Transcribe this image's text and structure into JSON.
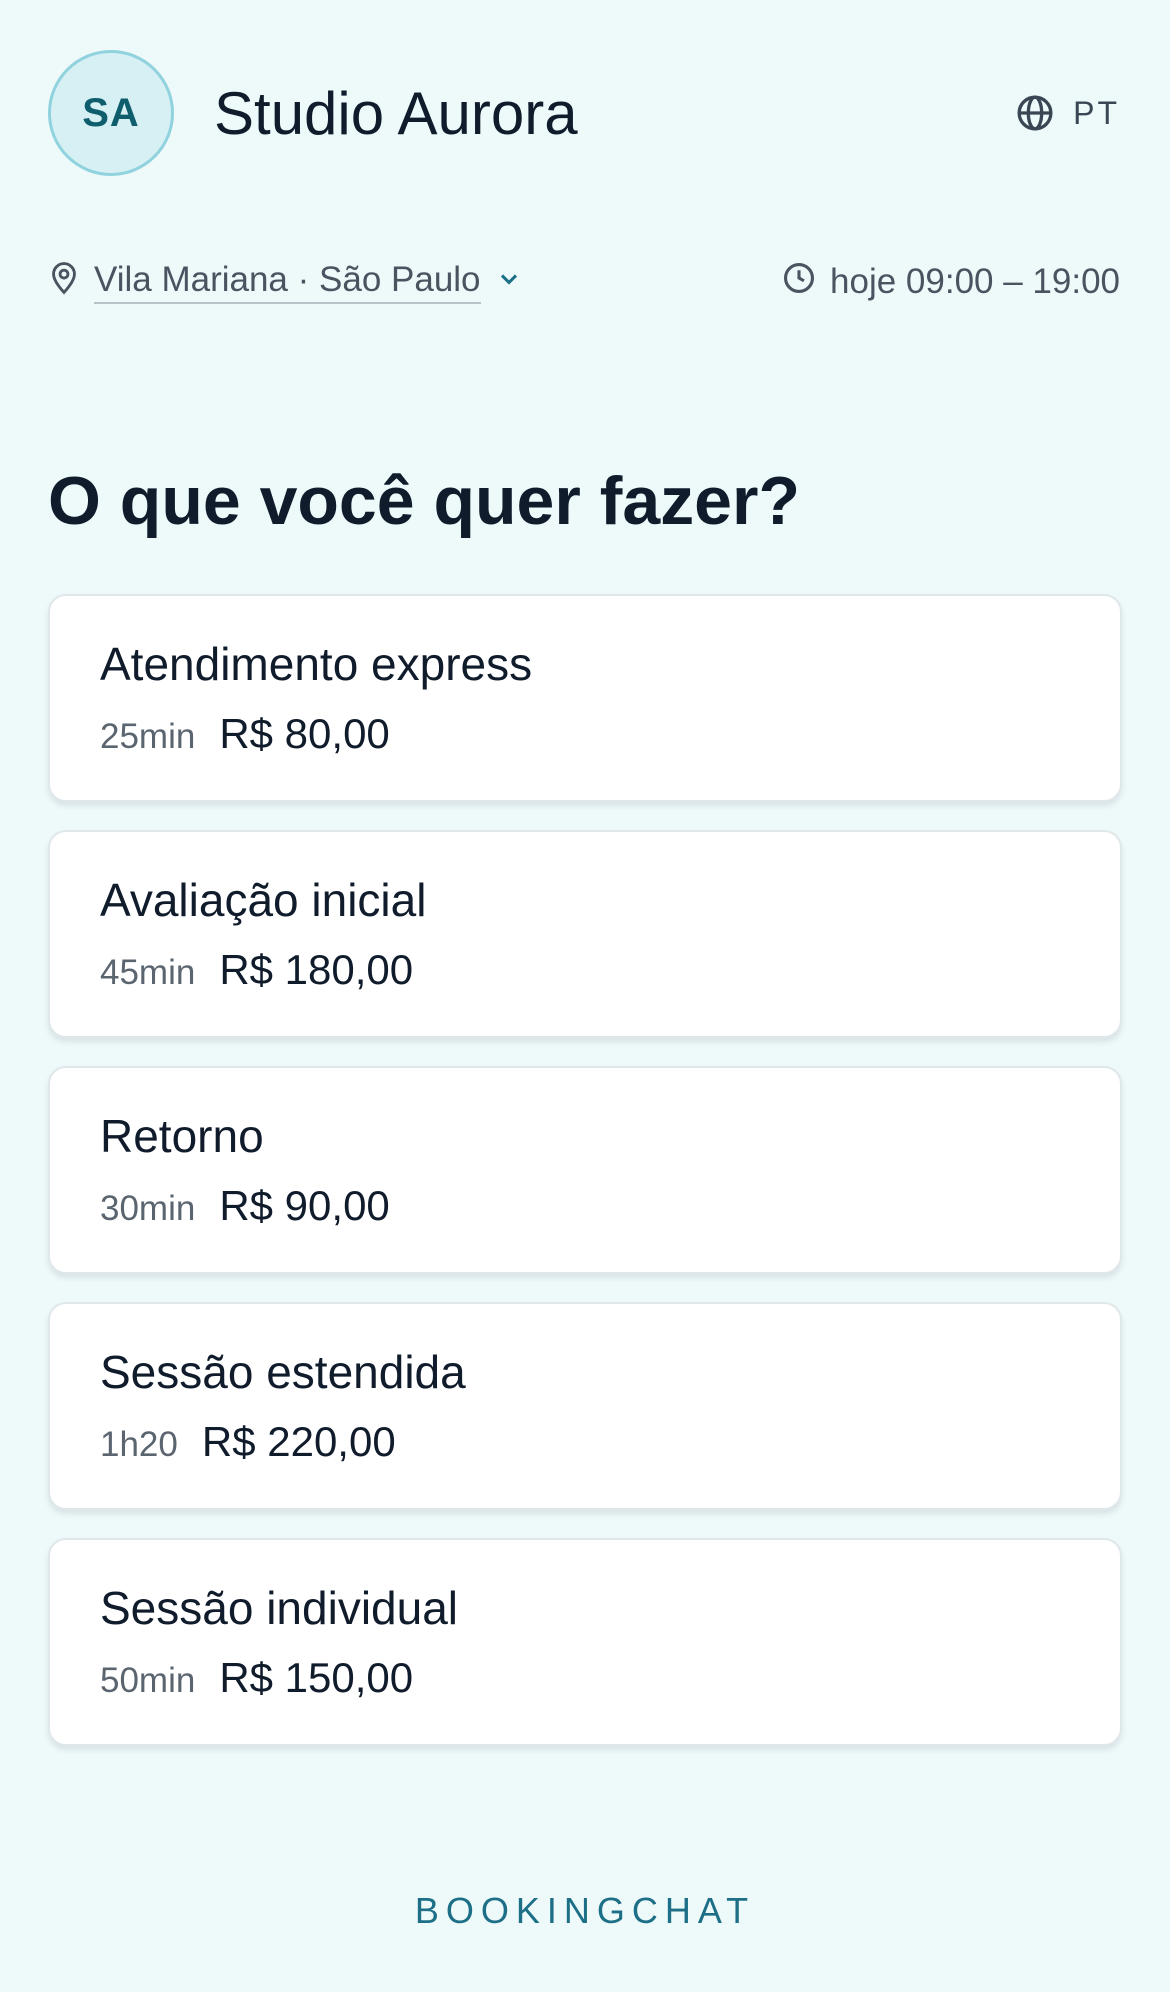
{
  "header": {
    "avatar_initials": "SA",
    "studio_name": "Studio Aurora",
    "language": "PT",
    "language_icon": "globe-icon"
  },
  "meta": {
    "location": "Vila Mariana · São Paulo",
    "location_icon": "map-pin-icon",
    "dropdown_icon": "chevron-down-icon",
    "hours": "hoje 09:00 – 19:00",
    "hours_icon": "clock-icon"
  },
  "main": {
    "question": "O que você quer fazer?",
    "services": [
      {
        "name": "Atendimento express",
        "duration": "25min",
        "price": "R$ 80,00"
      },
      {
        "name": "Avaliação inicial",
        "duration": "45min",
        "price": "R$ 180,00"
      },
      {
        "name": "Retorno",
        "duration": "30min",
        "price": "R$ 90,00"
      },
      {
        "name": "Sessão estendida",
        "duration": "1h20",
        "price": "R$ 220,00"
      },
      {
        "name": "Sessão individual",
        "duration": "50min",
        "price": "R$ 150,00"
      }
    ]
  },
  "footer": {
    "brand": "BOOKINGCHAT"
  },
  "colors": {
    "background": "#eef9fa",
    "accent": "#1c6f86",
    "avatar_bg": "#d7f0f4",
    "avatar_border": "#90d3de",
    "text": "#101c2c"
  }
}
